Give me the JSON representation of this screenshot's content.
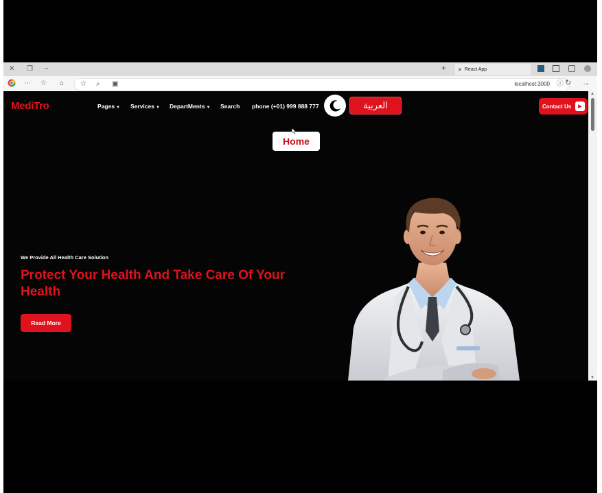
{
  "browser": {
    "tab_title": "React App",
    "url": "localhost:3000"
  },
  "site": {
    "logo": "MediTro",
    "nav": [
      {
        "label": "Pages",
        "dropdown": true
      },
      {
        "label": "Services",
        "dropdown": true
      },
      {
        "label": "DepartMents",
        "dropdown": true
      },
      {
        "label": "Search",
        "dropdown": false
      }
    ],
    "phone": "phone (+01) 999 888 777",
    "language_button": "العربية",
    "contact_button": "Contact Us",
    "tooltip": "Home"
  },
  "hero": {
    "subtitle": "We Provide All Health Care Solution",
    "headline": "Protect Your Health And Take Care Of Your Health",
    "cta": "Read More"
  },
  "colors": {
    "accent": "#e0121e",
    "background": "#050505",
    "text": "#ffffff"
  },
  "icons": [
    "close-icon",
    "restore-icon",
    "minimize-icon",
    "new-tab-icon",
    "moon-icon",
    "arrow-right-icon",
    "reload-icon",
    "info-icon"
  ]
}
